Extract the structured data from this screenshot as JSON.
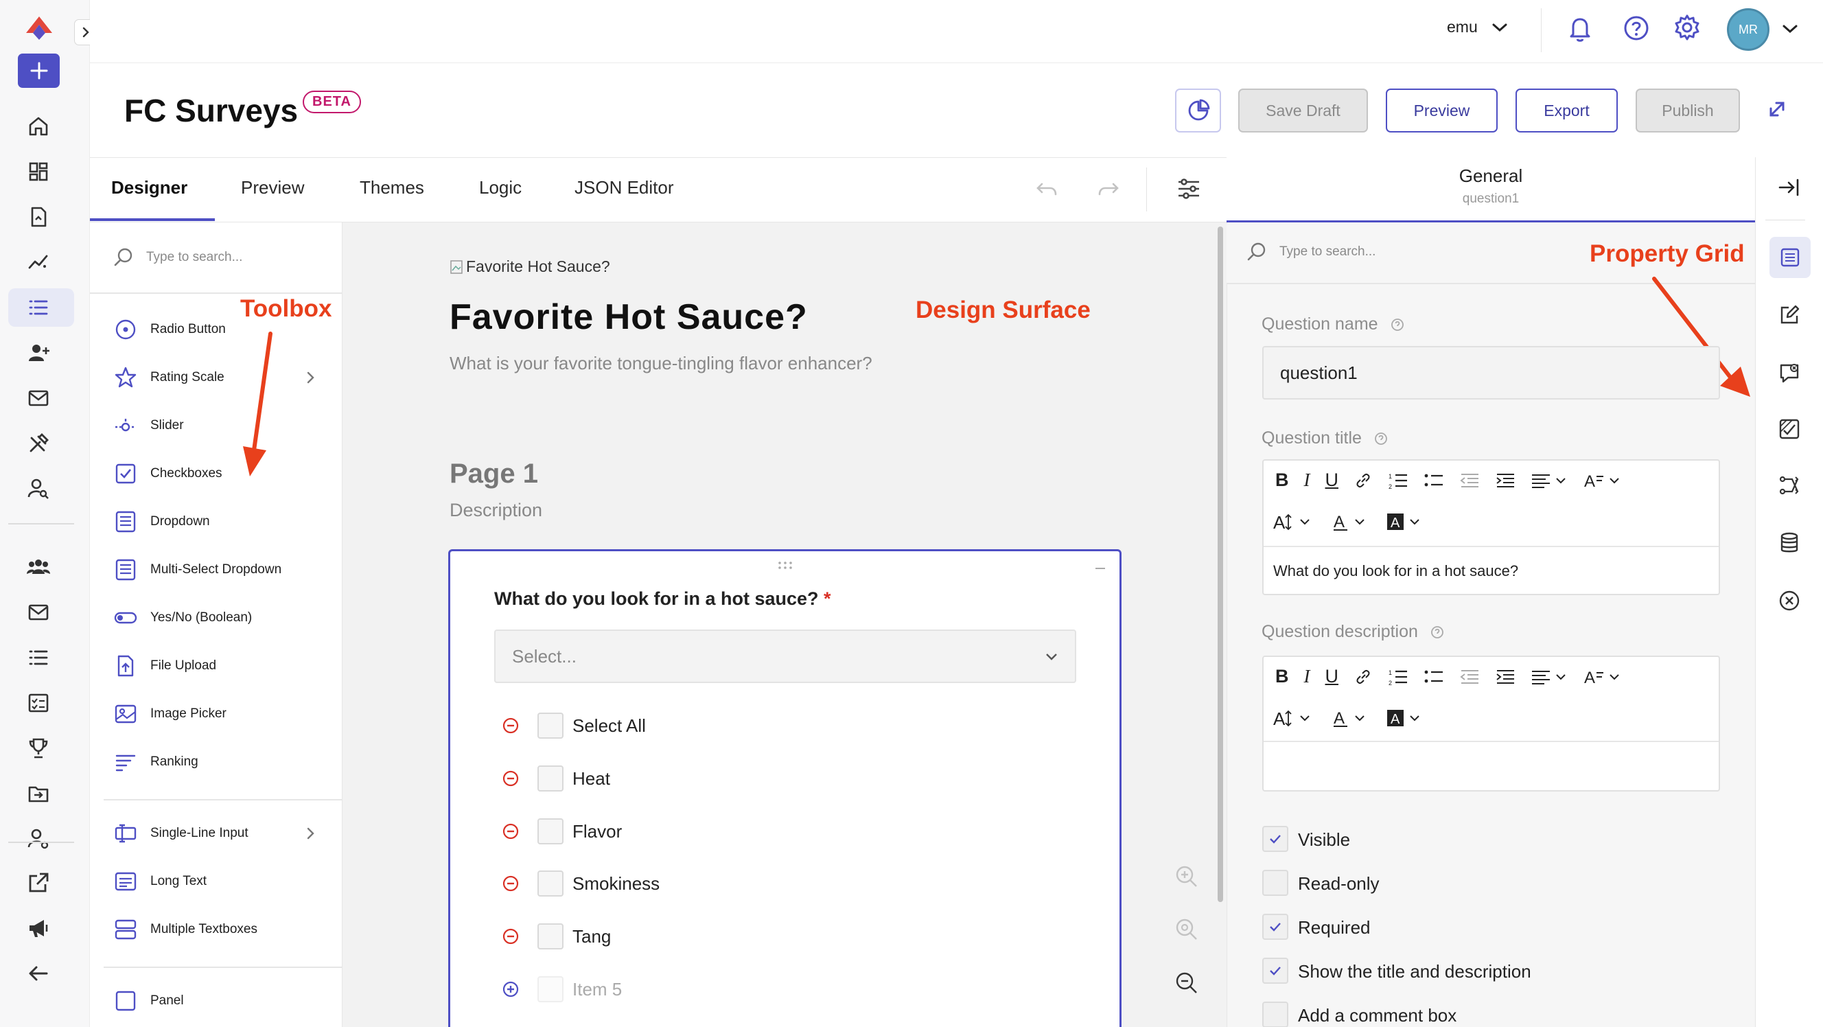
{
  "top_bar": {
    "user_label": "emu",
    "avatar_initials": "MR"
  },
  "header": {
    "title": "FC Surveys",
    "badge": "BETA",
    "buttons": {
      "save_draft": "Save Draft",
      "preview": "Preview",
      "export": "Export",
      "publish": "Publish"
    }
  },
  "tabs": [
    "Designer",
    "Preview",
    "Themes",
    "Logic",
    "JSON Editor"
  ],
  "toolbox": {
    "search_placeholder": "Type to search...",
    "items": [
      "Radio Button",
      "Rating Scale",
      "Slider",
      "Checkboxes",
      "Dropdown",
      "Multi-Select Dropdown",
      "Yes/No (Boolean)",
      "File Upload",
      "Image Picker",
      "Ranking",
      "Single-Line Input",
      "Long Text",
      "Multiple Textboxes",
      "Panel"
    ]
  },
  "surface": {
    "logo_alt": "Favorite Hot Sauce?",
    "survey_title": "Favorite Hot Sauce?",
    "survey_description": "What is your favorite tongue-tingling flavor enhancer?",
    "page_title": "Page 1",
    "page_description": "Description",
    "question_title": "What do you look for in a hot sauce?",
    "required_mark": "*",
    "dropdown_placeholder": "Select...",
    "choices": [
      "Select All",
      "Heat",
      "Flavor",
      "Smokiness",
      "Tang"
    ],
    "new_choice": "Item 5"
  },
  "property_grid": {
    "header_title": "General",
    "header_sub": "question1",
    "search_placeholder": "Type to search...",
    "question_name_label": "Question name",
    "question_name_value": "question1",
    "question_title_label": "Question title",
    "question_title_value": "What do you look for in a hot sauce?",
    "question_description_label": "Question description",
    "checkboxes": [
      {
        "label": "Visible",
        "checked": true
      },
      {
        "label": "Read-only",
        "checked": false
      },
      {
        "label": "Required",
        "checked": true
      },
      {
        "label": "Show the title and description",
        "checked": true
      },
      {
        "label": "Add a comment box",
        "checked": false
      }
    ]
  },
  "annotations": {
    "toolbox": "Toolbox",
    "design_surface": "Design Surface",
    "property_grid": "Property Grid"
  },
  "colors": {
    "accent": "#4e4fc4",
    "annotation": "#e8401c",
    "required": "#d93025"
  }
}
